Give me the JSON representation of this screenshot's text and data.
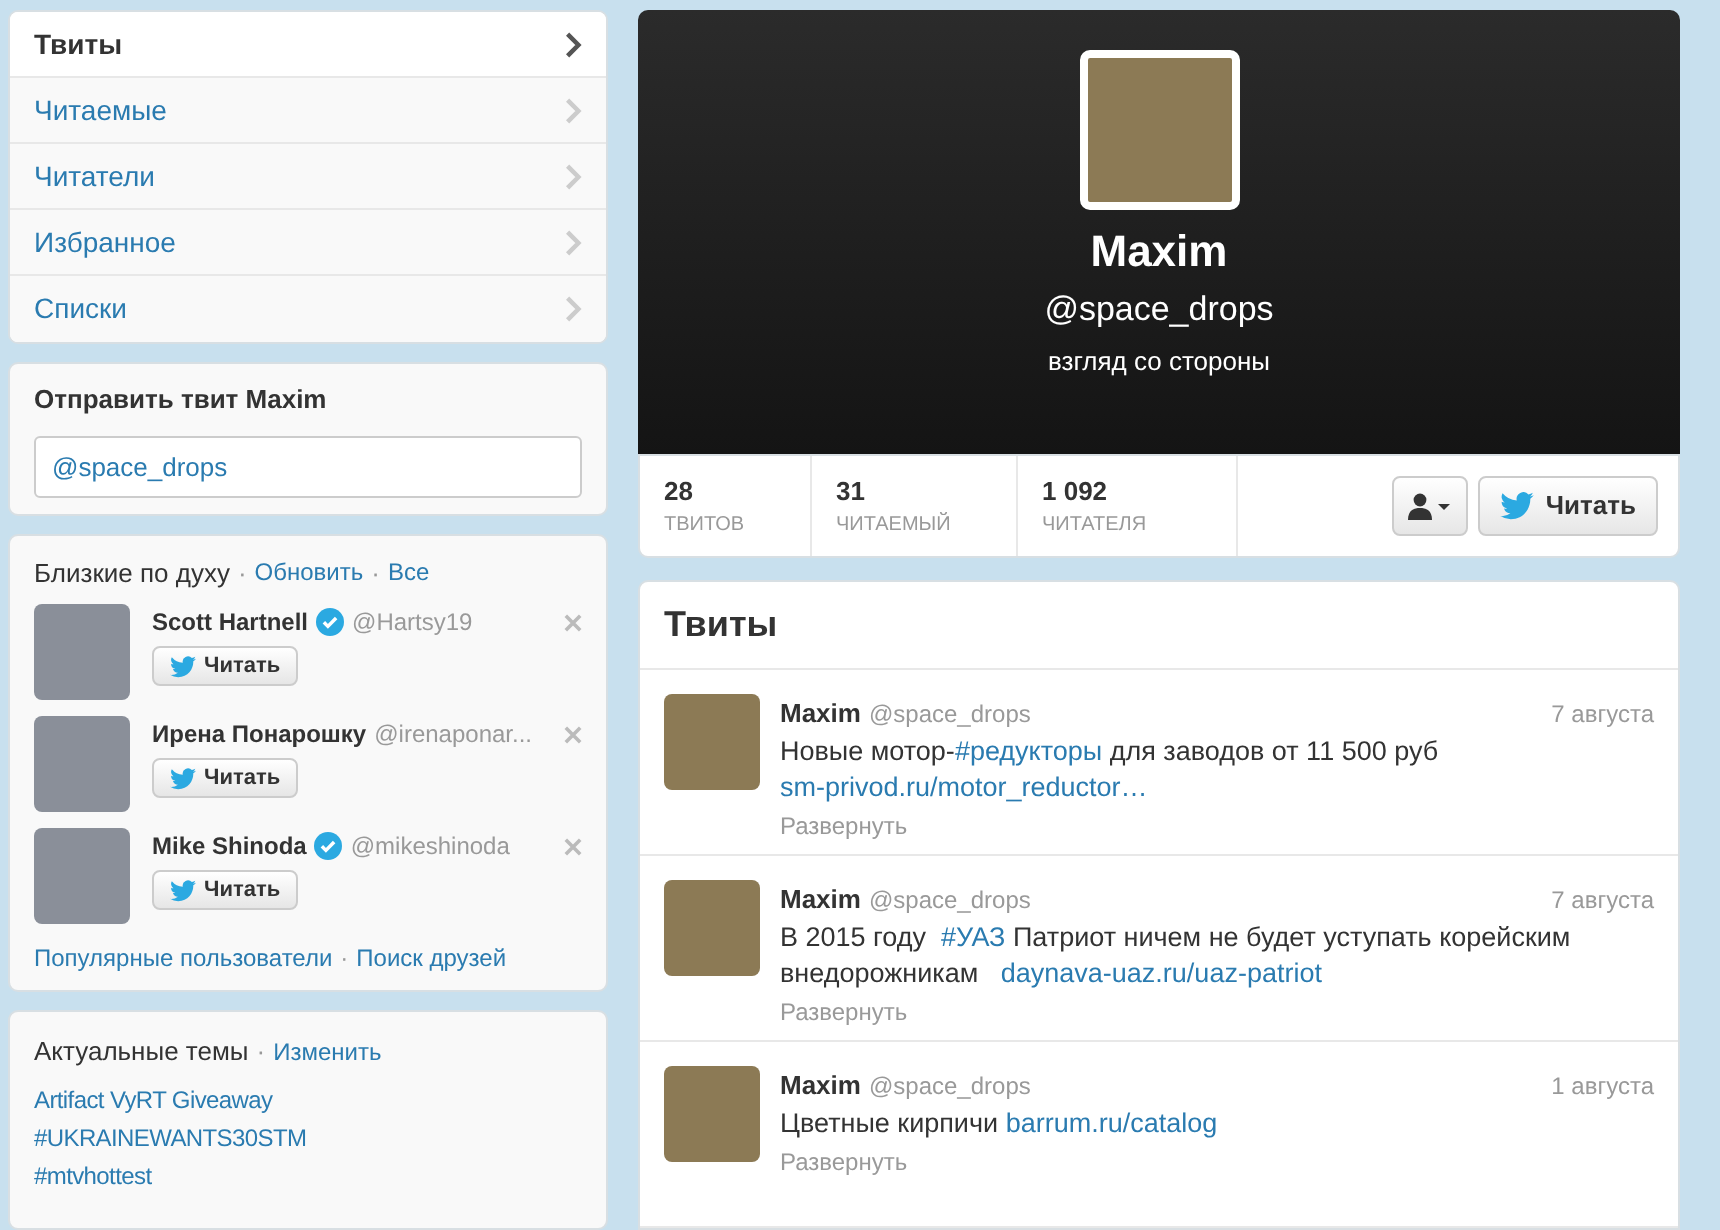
{
  "nav": {
    "items": [
      {
        "label": "Твиты",
        "selected": true
      },
      {
        "label": "Читаемые",
        "selected": false
      },
      {
        "label": "Читатели",
        "selected": false
      },
      {
        "label": "Избранное",
        "selected": false
      },
      {
        "label": "Списки",
        "selected": false
      }
    ]
  },
  "compose": {
    "title": "Отправить твит Maxim",
    "value": "@space_drops"
  },
  "who_to_follow": {
    "title": "Близкие по духу",
    "separator": "·",
    "actions": [
      "Обновить",
      "Все"
    ],
    "users": [
      {
        "name": "Scott Hartnell",
        "verified": true,
        "handle": "@Hartsy19",
        "button": "Читать"
      },
      {
        "name": "Ирена Понарошку",
        "verified": false,
        "handle": "@irenaponar...",
        "button": "Читать"
      },
      {
        "name": "Mike Shinoda",
        "verified": true,
        "handle": "@mikeshinoda",
        "button": "Читать"
      }
    ],
    "footer_links": [
      "Популярные пользователи",
      "Поиск друзей"
    ]
  },
  "trends": {
    "title": "Актуальные темы",
    "separator": "·",
    "action": "Изменить",
    "items": [
      "Artifact VyRT Giveaway",
      "#UKRAINEWANTS30STM",
      "#mtvhottest"
    ]
  },
  "profile": {
    "name": "Maxim",
    "handle": "@space_drops",
    "bio": "взгляд со стороны",
    "stats": [
      {
        "value": "28",
        "label": "ТВИТОВ"
      },
      {
        "value": "31",
        "label": "ЧИТАЕМЫЙ"
      },
      {
        "value": "1 092",
        "label": "ЧИТАТЕЛЯ"
      }
    ],
    "follow_button": "Читать"
  },
  "timeline": {
    "title": "Твиты",
    "tweets": [
      {
        "name": "Maxim",
        "handle": "@space_drops",
        "date": "7 августа",
        "expand": "Развернуть",
        "parts": [
          {
            "kind": "text",
            "text": "Новые мотор-"
          },
          {
            "kind": "link",
            "text": "#редукторы"
          },
          {
            "kind": "text",
            "text": " для заводов от 11 500 руб "
          },
          {
            "kind": "link",
            "text": "sm-privod.ru/motor_reductor…"
          }
        ]
      },
      {
        "name": "Maxim",
        "handle": "@space_drops",
        "date": "7 августа",
        "expand": "Развернуть",
        "parts": [
          {
            "kind": "text",
            "text": "В 2015 году  "
          },
          {
            "kind": "link",
            "text": "#УАЗ"
          },
          {
            "kind": "text",
            "text": " Патриот ничем не будет уступать корейским внедорожникам   "
          },
          {
            "kind": "link",
            "text": "daynava-uaz.ru/uaz-patriot"
          }
        ]
      },
      {
        "name": "Maxim",
        "handle": "@space_drops",
        "date": "1 августа",
        "expand": "Развернуть",
        "parts": [
          {
            "kind": "text",
            "text": "Цветные кирпичи "
          },
          {
            "kind": "link",
            "text": "barrum.ru/catalog"
          }
        ]
      }
    ]
  }
}
